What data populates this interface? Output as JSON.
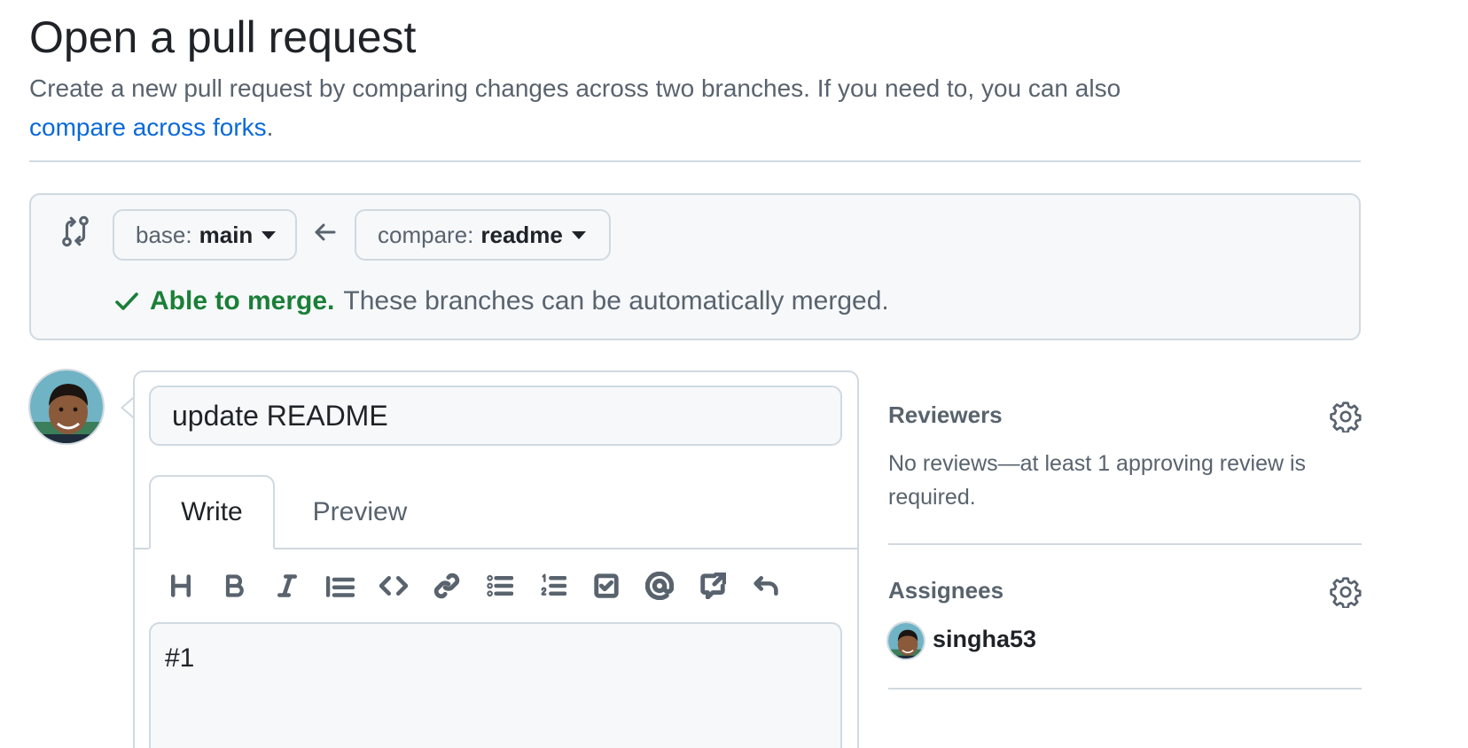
{
  "header": {
    "title": "Open a pull request",
    "subtitle": "Create a new pull request by comparing changes across two branches. If you need to, you can also",
    "fork_link": "compare across forks",
    "fork_link_suffix": "."
  },
  "compare": {
    "base_label": "base:",
    "base_branch": "main",
    "compare_label": "compare:",
    "compare_branch": "readme",
    "merge_status": "Able to merge.",
    "merge_detail": "These branches can be automatically merged."
  },
  "editor": {
    "title_value": "update README",
    "tabs": [
      "Write",
      "Preview"
    ],
    "active_tab": "Write",
    "toolbar": [
      "heading-icon",
      "bold-icon",
      "italic-icon",
      "quote-icon",
      "code-icon",
      "link-icon",
      "unordered-list-icon",
      "ordered-list-icon",
      "task-list-icon",
      "mention-icon",
      "reference-icon",
      "undo-icon"
    ],
    "body_value": "#1"
  },
  "sidebar": {
    "reviewers": {
      "title": "Reviewers",
      "text": "No reviews—at least 1 approving review is required."
    },
    "assignees": {
      "title": "Assignees",
      "user": "singha53"
    }
  },
  "colors": {
    "link": "#0969da",
    "success": "#1a7f37",
    "muted": "#59636e",
    "border": "#d1d9e0",
    "canvas_subtle": "#f6f8fa"
  }
}
